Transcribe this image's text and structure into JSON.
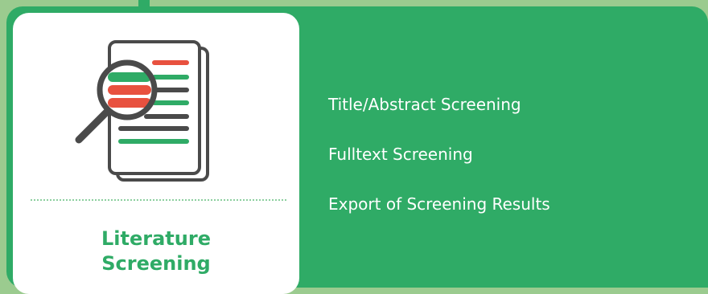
{
  "card": {
    "title_line1": "Literature",
    "title_line2": "Screening",
    "icon": "magnifier-document-icon"
  },
  "menu": {
    "items": [
      {
        "label": "Title/Abstract Screening"
      },
      {
        "label": "Fulltext Screening"
      },
      {
        "label": "Export of Screening Results"
      }
    ]
  },
  "colors": {
    "background": "#9bcb8f",
    "panel": "#2fab66",
    "card": "#ffffff",
    "accent_red": "#e8513f",
    "icon_dark": "#4a4a4a"
  }
}
